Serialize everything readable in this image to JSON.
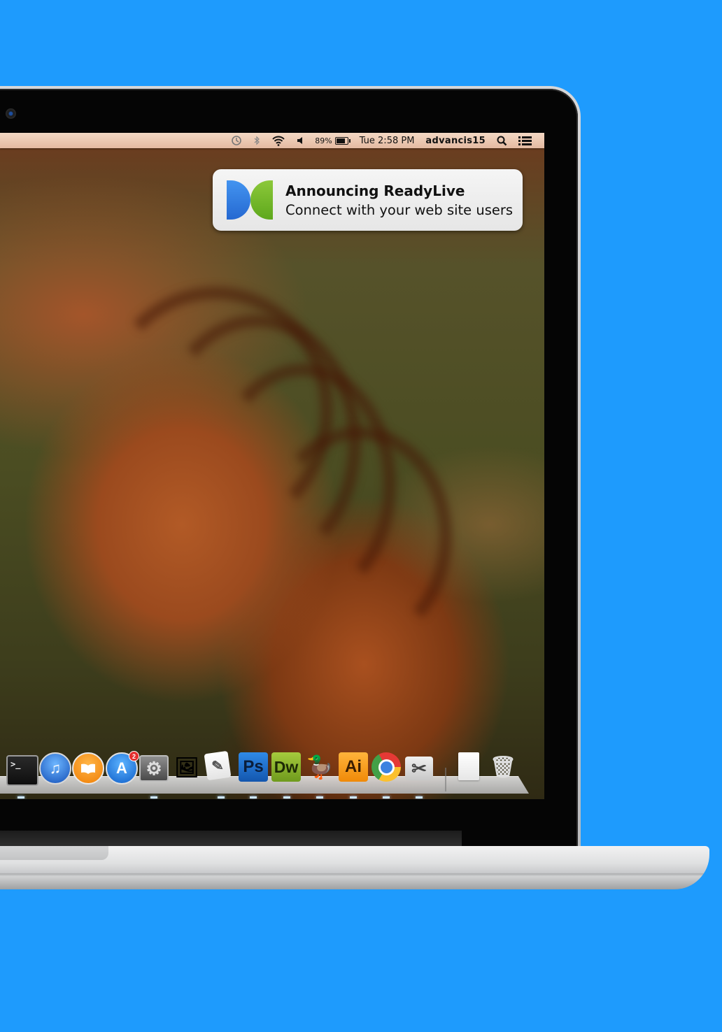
{
  "menubar": {
    "icons": [
      "time-machine-icon",
      "bluetooth-icon",
      "wifi-icon",
      "volume-icon"
    ],
    "battery_percent": "89%",
    "clock": "Tue 2:58 PM",
    "user": "advancis15"
  },
  "notification": {
    "app_logo": "readylive-logo",
    "title": "Announcing ReadyLive",
    "body": "Connect with your web site users"
  },
  "dock": {
    "items": [
      {
        "name": "Terminal",
        "glyph": ">_",
        "running": true
      },
      {
        "name": "iTunes",
        "glyph": "♫",
        "running": false
      },
      {
        "name": "iBooks",
        "glyph": "📖",
        "running": false
      },
      {
        "name": "App Store",
        "glyph": "A",
        "badge": "2",
        "running": false
      },
      {
        "name": "System Preferences",
        "glyph": "⚙",
        "running": true
      },
      {
        "name": "Preview",
        "glyph": "🖼",
        "running": false
      },
      {
        "name": "TextEdit",
        "glyph": "✎",
        "running": true
      },
      {
        "name": "Photoshop",
        "glyph": "Ps",
        "running": true
      },
      {
        "name": "Dreamweaver",
        "glyph": "Dw",
        "running": true
      },
      {
        "name": "Cyberduck",
        "glyph": "🦆",
        "running": true
      },
      {
        "name": "Illustrator",
        "glyph": "Ai",
        "running": true
      },
      {
        "name": "Chrome",
        "glyph": "",
        "running": true
      },
      {
        "name": "Grab",
        "glyph": "✂",
        "running": true
      },
      {
        "name": "Documents",
        "glyph": "",
        "running": false
      },
      {
        "name": "Trash",
        "glyph": "🗑",
        "running": false
      }
    ]
  },
  "colors": {
    "background": "#1e9bfd",
    "photoshop": "#1b6fc9",
    "dreamweaver": "#8fb62d",
    "illustrator": "#f39a1b",
    "notification_blue": "#2f7fe6",
    "notification_green": "#79bd2c"
  }
}
